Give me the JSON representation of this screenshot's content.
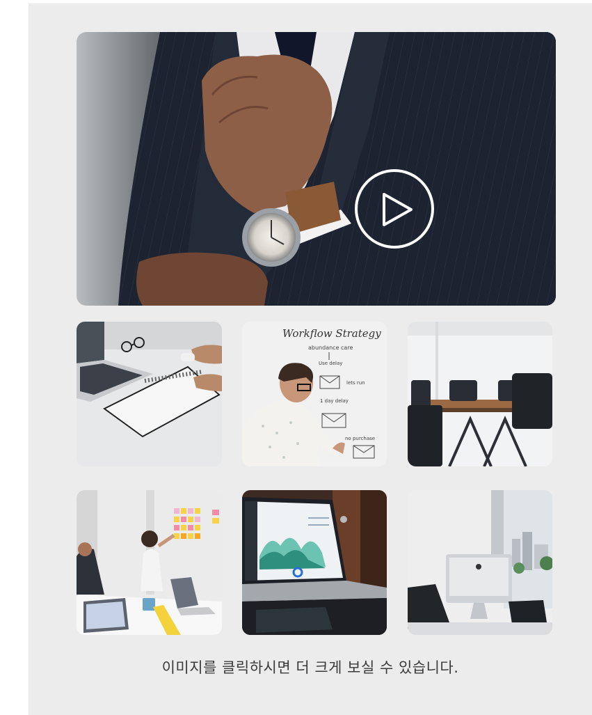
{
  "gallery": {
    "hero": {
      "alt": "Man in pinstripe suit adjusting tie, wearing a wristwatch",
      "play_icon": "play-circle-icon"
    },
    "thumbnails": [
      {
        "alt": "Desk with laptop, notebook, glasses and hands"
      },
      {
        "alt": "Man writing workflow diagram on whiteboard"
      },
      {
        "alt": "Empty conference room with black chairs"
      },
      {
        "alt": "Team meeting with sticky notes on wall"
      },
      {
        "alt": "Laptop showing analytics dashboard"
      },
      {
        "alt": "iMac on desk in bright office with city view"
      }
    ],
    "whiteboard_title": "Workflow  Strategy",
    "whiteboard_lines": [
      "abundance care",
      "Use delay",
      "lets run",
      "1 day delay",
      "no purchase"
    ]
  },
  "caption": "이미지를 클릭하시면 더 크게 보실 수 있습니다."
}
